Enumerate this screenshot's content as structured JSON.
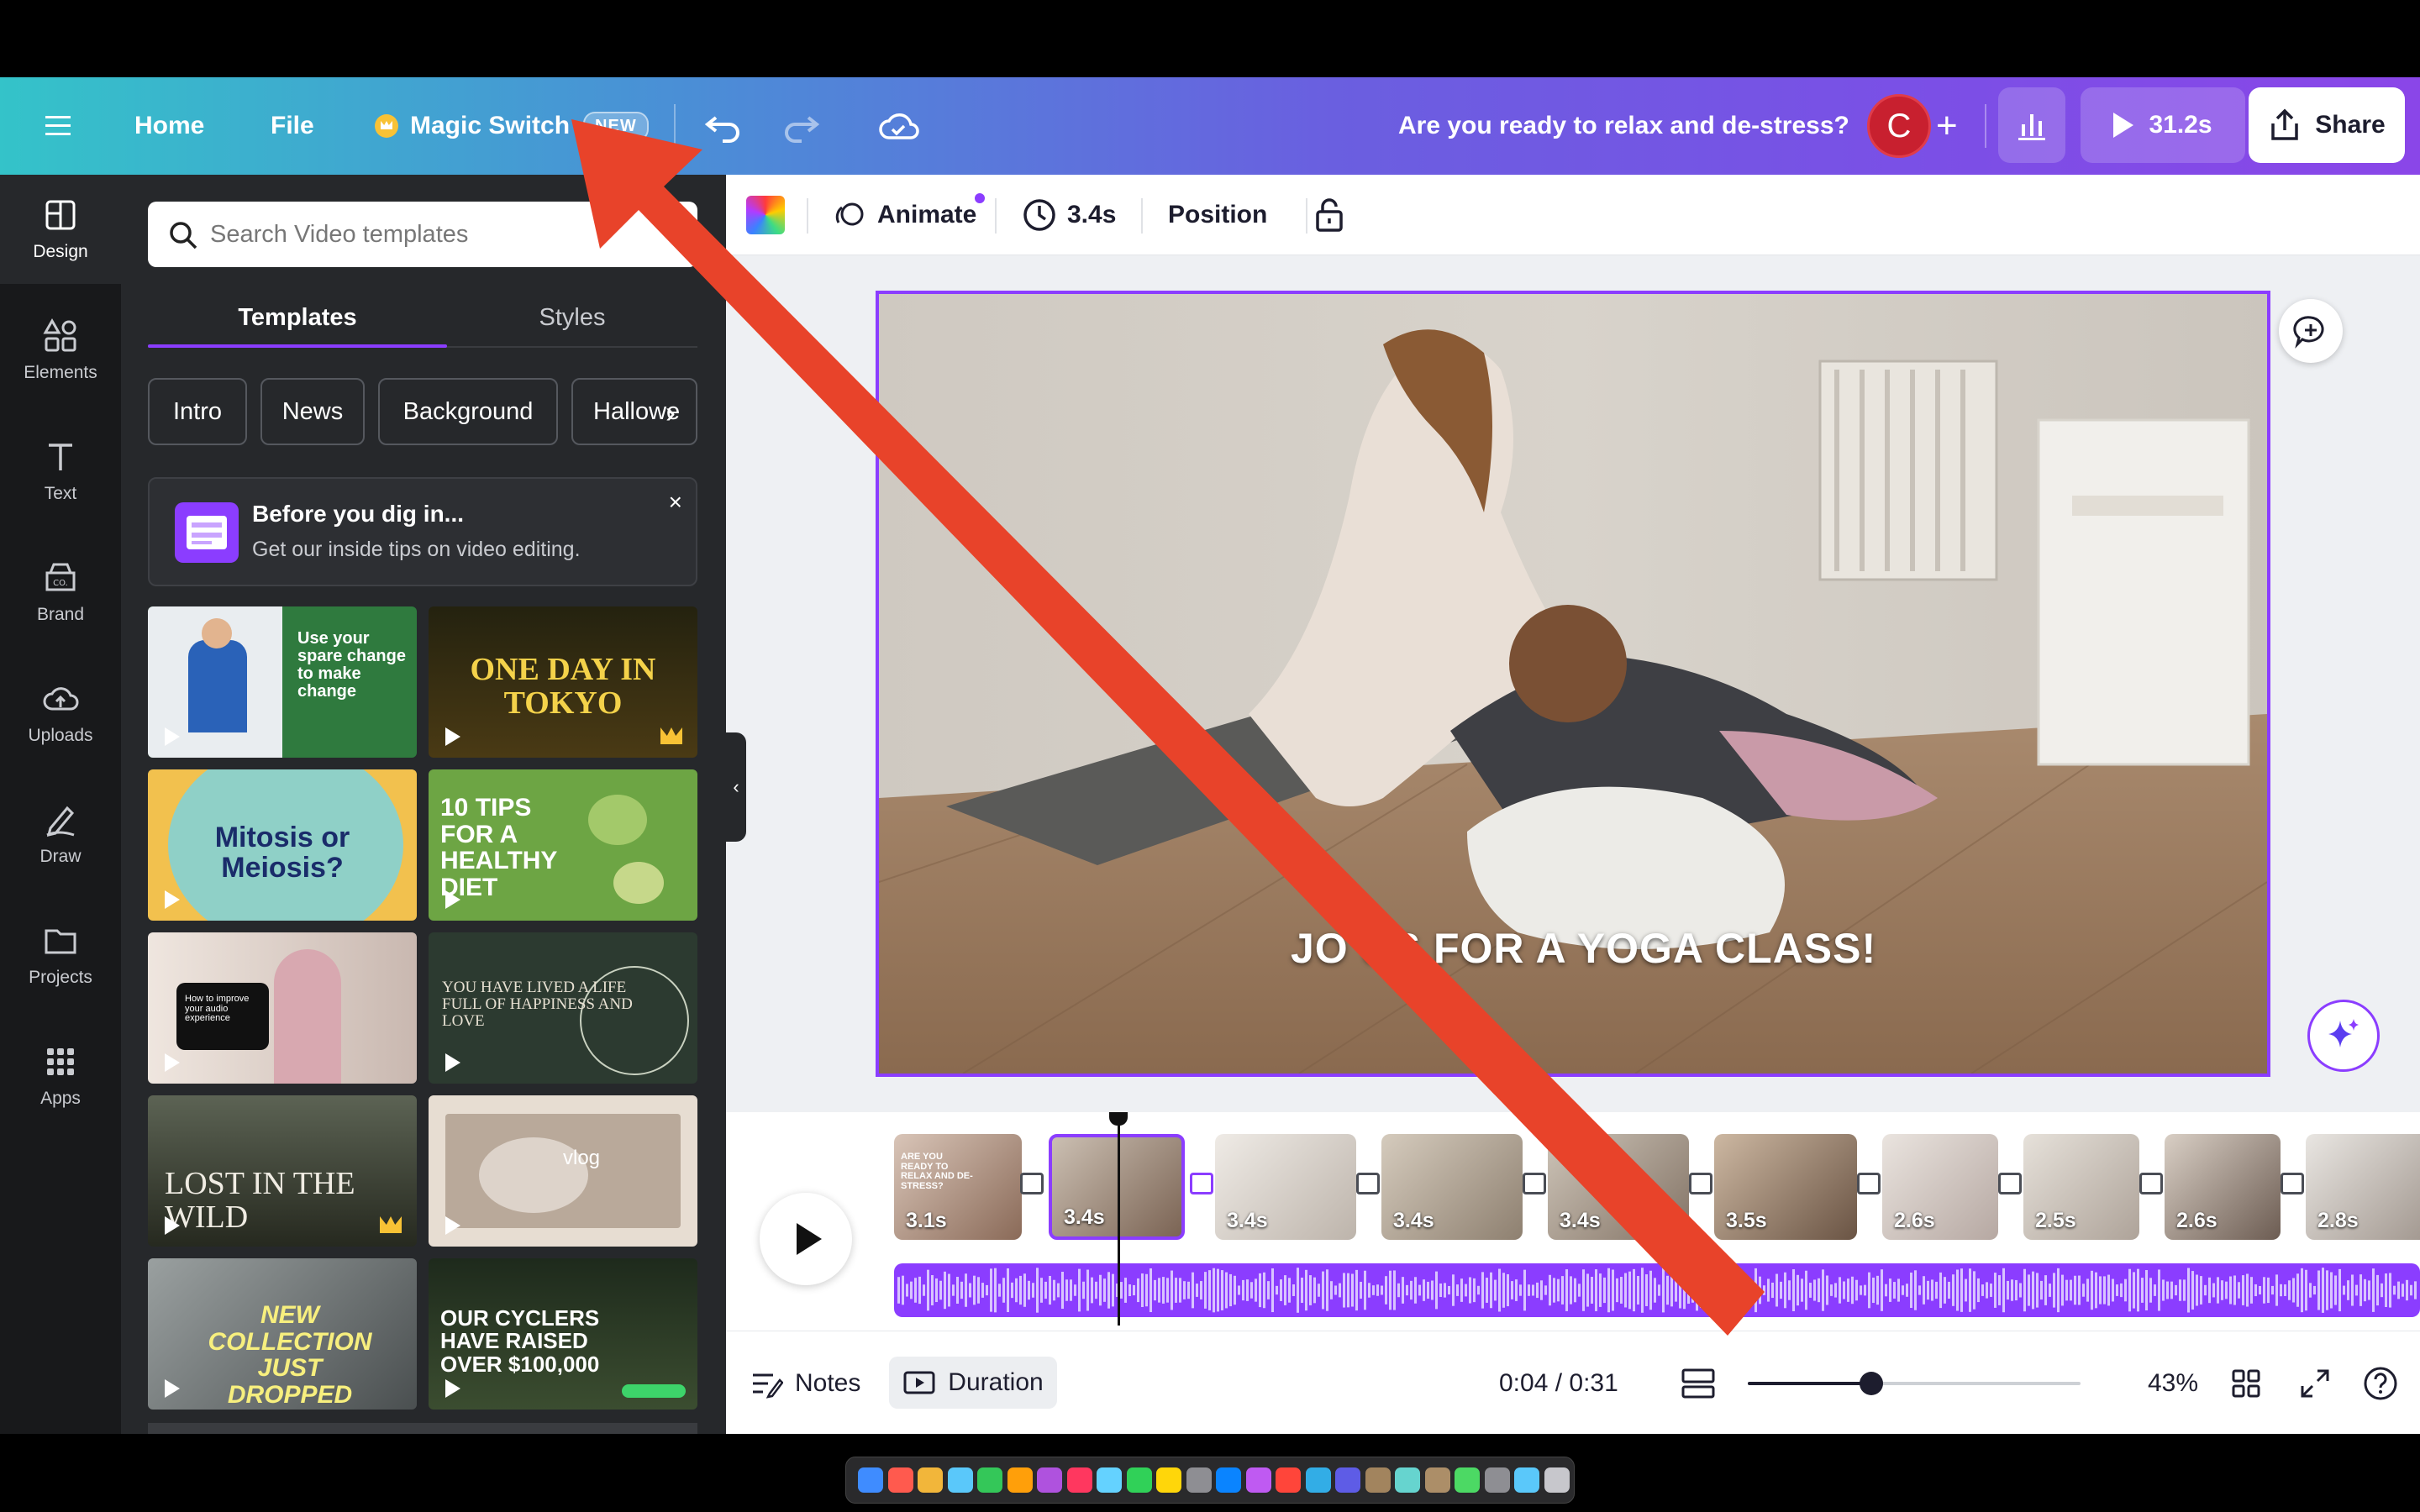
{
  "topbar": {
    "home": "Home",
    "file": "File",
    "magic_switch": "Magic Switch",
    "new_badge": "NEW",
    "design_title": "Are you ready to relax and de-stress?",
    "avatar_letter": "C",
    "plus": "+",
    "play_time": "31.2s",
    "share": "Share"
  },
  "rail": [
    {
      "label": "Design",
      "icon": "design-icon"
    },
    {
      "label": "Elements",
      "icon": "elements-icon"
    },
    {
      "label": "Text",
      "icon": "text-icon"
    },
    {
      "label": "Brand",
      "icon": "brand-icon"
    },
    {
      "label": "Uploads",
      "icon": "uploads-icon"
    },
    {
      "label": "Draw",
      "icon": "draw-icon"
    },
    {
      "label": "Projects",
      "icon": "projects-icon"
    },
    {
      "label": "Apps",
      "icon": "apps-icon"
    }
  ],
  "panel": {
    "search_placeholder": "Search Video templates",
    "tabs": [
      "Templates",
      "Styles"
    ],
    "chips": [
      "Intro",
      "News",
      "Background",
      "Hallowe"
    ],
    "tip_title": "Before you dig in...",
    "tip_sub": "Get our inside tips on video editing.",
    "tip_close": "×",
    "thumbs": [
      {
        "text": "Use your spare change to make change",
        "bg": "#2f7a3e"
      },
      {
        "text": "ONE DAY IN TOKYO",
        "bg": "#3a3016"
      },
      {
        "text": "Mitosis or Meiosis?",
        "bg": "#f2c14e"
      },
      {
        "text": "10 TIPS FOR A HEALTHY DIET",
        "bg": "#6da544"
      },
      {
        "text": "How to improve your audio experience",
        "bg": "#c9b8b0"
      },
      {
        "text": "YOU HAVE LIVED A LIFE FULL OF HAPPINESS AND LOVE",
        "bg": "#2c3a30"
      },
      {
        "text": "LOST IN THE WILD",
        "bg": "#3b4038"
      },
      {
        "text": "vlog",
        "bg": "#d7cbbf"
      },
      {
        "text": "NEW COLLECTION JUST DROPPED",
        "bg": "#6e7272"
      },
      {
        "text": "OUR CYCLERS HAVE RAISED OVER $100,000",
        "bg": "#2e3b2a"
      }
    ]
  },
  "context_toolbar": {
    "animate": "Animate",
    "duration": "3.4s",
    "position": "Position"
  },
  "canvas": {
    "caption": "JO  US FOR A YOGA CLASS!"
  },
  "timeline": {
    "clips": [
      "3.1s",
      "3.4s",
      "3.4s",
      "3.4s",
      "3.4s",
      "3.5s",
      "2.6s",
      "2.5s",
      "2.6s",
      "2.8s"
    ],
    "clip1_overlay": "ARE YOU READY TO RELAX AND DE-STRESS?"
  },
  "bottombar": {
    "notes": "Notes",
    "duration": "Duration",
    "time": "0:04 / 0:31",
    "zoom": "43%",
    "zoom_level": 0.37
  },
  "colors": {
    "accent": "#8b3dff",
    "arrow": "#e8432a"
  }
}
